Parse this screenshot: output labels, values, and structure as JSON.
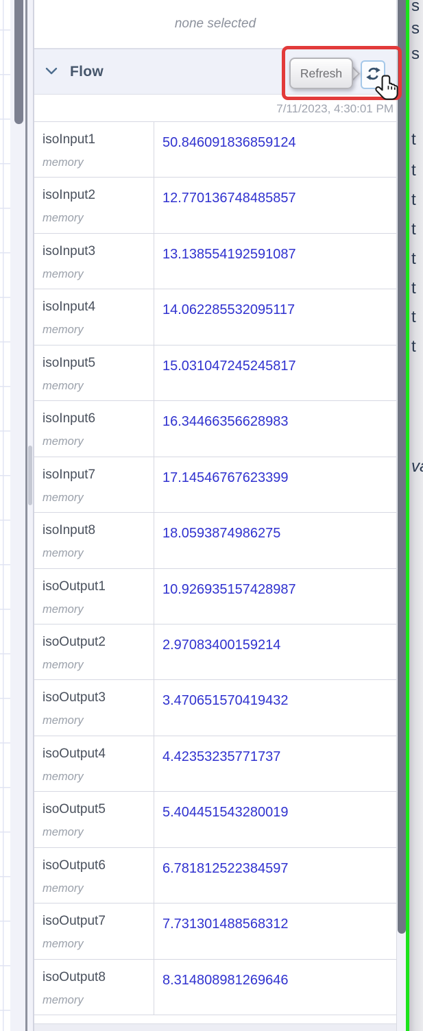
{
  "panel": {
    "selection_status": "none selected",
    "flow_section": {
      "title": "Flow",
      "refresh_tooltip": "Refresh",
      "timestamp": "7/11/2023, 4:30:01 PM",
      "rows": [
        {
          "name": "isoInput1",
          "type": "memory",
          "value": "50.846091836859124"
        },
        {
          "name": "isoInput2",
          "type": "memory",
          "value": "12.770136748485857"
        },
        {
          "name": "isoInput3",
          "type": "memory",
          "value": "13.138554192591087"
        },
        {
          "name": "isoInput4",
          "type": "memory",
          "value": "14.062285532095117"
        },
        {
          "name": "isoInput5",
          "type": "memory",
          "value": "15.031047245245817"
        },
        {
          "name": "isoInput6",
          "type": "memory",
          "value": "16.34466356628983"
        },
        {
          "name": "isoInput7",
          "type": "memory",
          "value": "17.14546767623399"
        },
        {
          "name": "isoInput8",
          "type": "memory",
          "value": "18.0593874986275"
        },
        {
          "name": "isoOutput1",
          "type": "memory",
          "value": "10.926935157428987"
        },
        {
          "name": "isoOutput2",
          "type": "memory",
          "value": "2.97083400159214"
        },
        {
          "name": "isoOutput3",
          "type": "memory",
          "value": "3.470651570419432"
        },
        {
          "name": "isoOutput4",
          "type": "memory",
          "value": "4.42353235771737"
        },
        {
          "name": "isoOutput5",
          "type": "memory",
          "value": "5.404451543280019"
        },
        {
          "name": "isoOutput6",
          "type": "memory",
          "value": "6.781812522384597"
        },
        {
          "name": "isoOutput7",
          "type": "memory",
          "value": "7.731301488568312"
        },
        {
          "name": "isoOutput8",
          "type": "memory",
          "value": "8.314808981269646"
        }
      ]
    }
  },
  "right_edge_fragments": [
    "s",
    "s",
    "s",
    "t",
    "t",
    "t",
    "t",
    "t",
    "t",
    "t",
    "t",
    "va"
  ],
  "icons": {
    "chevron": "chevron-down-icon",
    "refresh": "refresh-icon",
    "cursor": "hand-cursor"
  },
  "colors": {
    "highlight_red": "#e23a3a",
    "value_blue": "#3032cf",
    "accent_green": "#1be41b",
    "header_bg": "#eff1f9"
  }
}
